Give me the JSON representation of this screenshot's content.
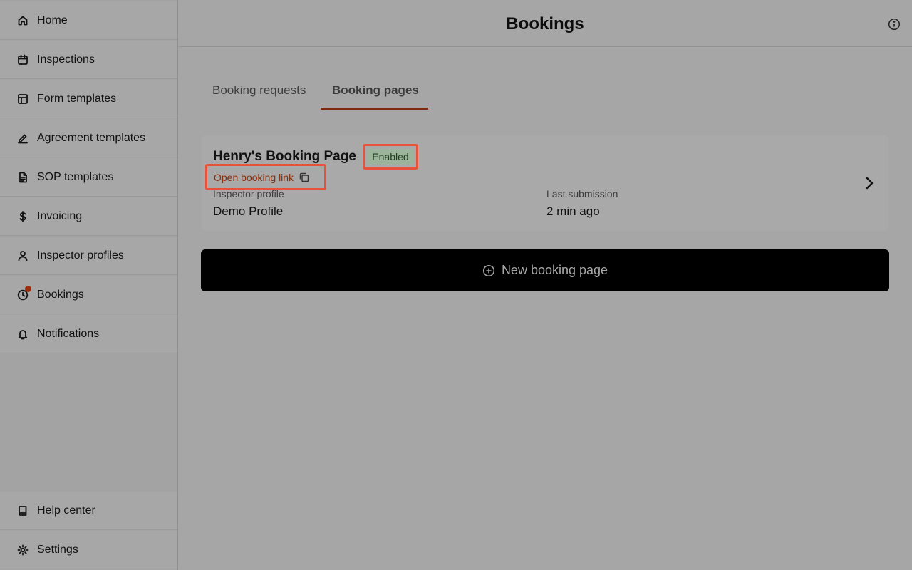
{
  "sidebar": {
    "items": [
      {
        "label": "Home",
        "icon": "home-icon"
      },
      {
        "label": "Inspections",
        "icon": "calendar-icon"
      },
      {
        "label": "Form templates",
        "icon": "layout-icon"
      },
      {
        "label": "Agreement templates",
        "icon": "signature-icon"
      },
      {
        "label": "SOP templates",
        "icon": "document-icon"
      },
      {
        "label": "Invoicing",
        "icon": "dollar-icon"
      },
      {
        "label": "Inspector profiles",
        "icon": "user-icon"
      },
      {
        "label": "Bookings",
        "icon": "clock-icon",
        "has_notification": true
      },
      {
        "label": "Notifications",
        "icon": "bell-icon"
      }
    ],
    "footer_items": [
      {
        "label": "Help center",
        "icon": "book-icon"
      },
      {
        "label": "Settings",
        "icon": "gear-icon"
      }
    ]
  },
  "header": {
    "title": "Bookings",
    "info_icon": "info-icon"
  },
  "tabs": [
    {
      "label": "Booking requests",
      "active": false
    },
    {
      "label": "Booking pages",
      "active": true
    }
  ],
  "booking_page": {
    "title": "Henry's Booking Page",
    "status": "Enabled",
    "link_label": "Open booking link",
    "fields": [
      {
        "label": "Inspector profile",
        "value": "Demo Profile"
      },
      {
        "label": "Last submission",
        "value": "2 min ago"
      }
    ]
  },
  "new_button": {
    "label": "New booking page"
  },
  "colors": {
    "accent": "#7e2b0f",
    "highlight_border": "#e8523a",
    "notification_dot": "#9a2e0c",
    "status_badge_bg": "#9db49c"
  }
}
